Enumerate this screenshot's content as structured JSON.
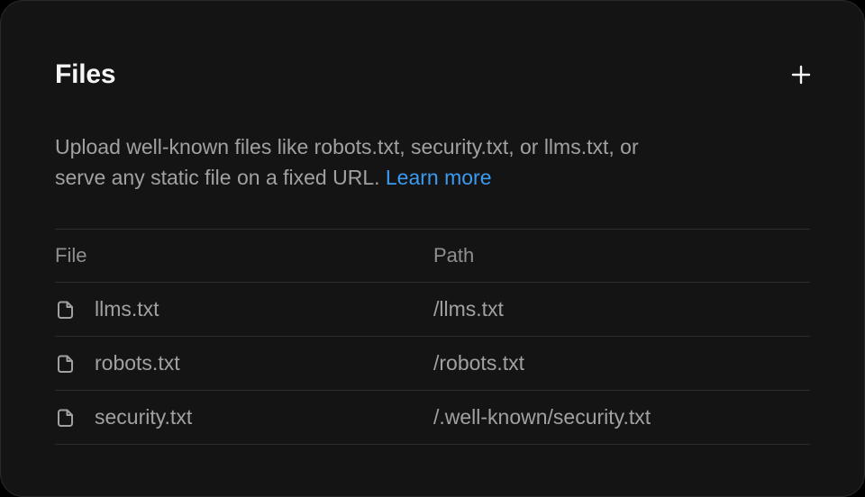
{
  "card": {
    "title": "Files",
    "add_icon": "plus-icon",
    "description": "Upload well-known files like robots.txt, security.txt, or llms.txt, or serve any static file on a fixed URL.",
    "learn_more_label": "Learn more"
  },
  "table": {
    "headers": {
      "file": "File",
      "path": "Path"
    },
    "rows": [
      {
        "icon": "file-icon",
        "file": "llms.txt",
        "path": "/llms.txt"
      },
      {
        "icon": "file-icon",
        "file": "robots.txt",
        "path": "/robots.txt"
      },
      {
        "icon": "file-icon",
        "file": "security.txt",
        "path": "/.well-known/security.txt"
      }
    ]
  },
  "colors": {
    "background": "#141414",
    "border": "#2b2b2b",
    "title": "#f5f5f5",
    "muted_text": "#a1a1a1",
    "link": "#3b9bf0"
  }
}
